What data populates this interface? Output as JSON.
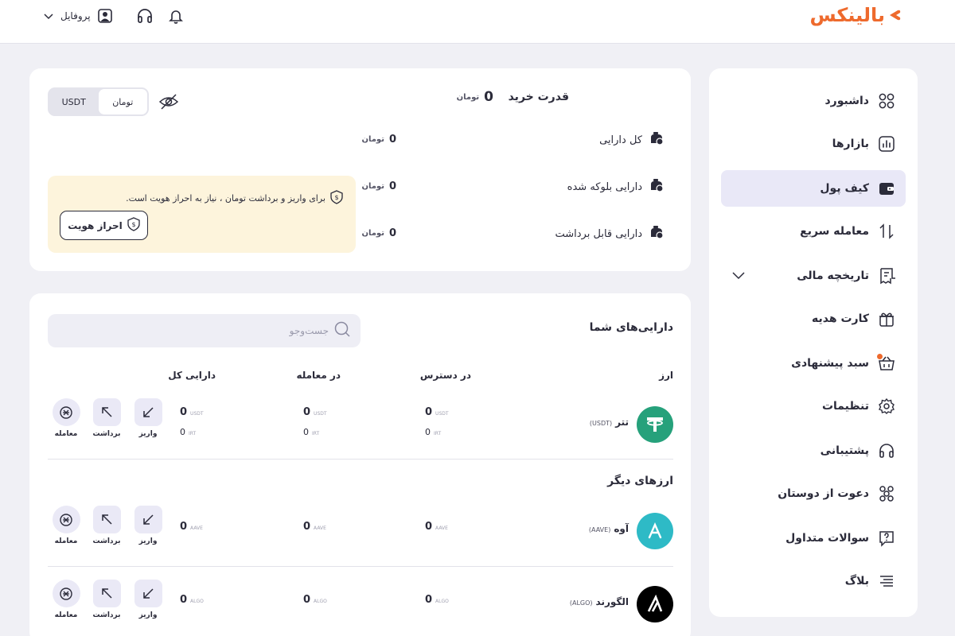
{
  "header": {
    "logo_text": "بالینکس",
    "profile_label": "پروفایل",
    "icons": [
      "chevron-down-icon",
      "user-icon",
      "headset-icon",
      "bell-icon"
    ]
  },
  "sidebar": {
    "items": [
      {
        "label": "داشبورد",
        "icon": "grid-icon"
      },
      {
        "label": "بازارها",
        "icon": "chart-icon"
      },
      {
        "label": "کیف پول",
        "icon": "wallet-icon",
        "active": true
      },
      {
        "label": "معامله سریع",
        "icon": "swap-icon"
      },
      {
        "label": "تاریخچه مالی",
        "icon": "receipt-icon",
        "expandable": true
      },
      {
        "label": "کارت هدیه",
        "icon": "gift-icon"
      },
      {
        "label": "سبد پیشنهادی",
        "icon": "basket-icon",
        "badge": true
      },
      {
        "label": "تنظیمات",
        "icon": "gear-icon"
      },
      {
        "label": "پشتیبانی",
        "icon": "headset-icon"
      },
      {
        "label": "دعوت از دوستان",
        "icon": "users-icon"
      },
      {
        "label": "سوالات متداول",
        "icon": "faq-icon"
      },
      {
        "label": "بلاگ",
        "icon": "list-icon"
      }
    ]
  },
  "summary": {
    "buying_power_label": "قدرت خرید",
    "buying_power_value": "0",
    "currency_sign": "تومان",
    "toggle": {
      "options": [
        "تومان",
        "USDT"
      ],
      "selected": "تومان"
    },
    "rows": [
      {
        "label": "کل دارایی",
        "value": "0"
      },
      {
        "label": "دارایی بلوکه شده",
        "value": "0"
      },
      {
        "label": "دارایی قابل برداشت",
        "value": "0"
      }
    ],
    "kyc": {
      "message": "برای واریز و برداشت تومان ، نیاز به احراز هویت است.",
      "button_label": "احراز هویت"
    }
  },
  "assets": {
    "title": "دارایی‌های شما",
    "search_placeholder": "جست‌وجو",
    "columns": {
      "coin": "ارز",
      "available": "در دسترس",
      "in_trade": "در معامله",
      "total": "دارایی کل"
    },
    "actions": {
      "deposit": "واریز",
      "withdraw": "برداشت",
      "trade": "معامله"
    },
    "primary": [
      {
        "name": "تتر",
        "symbol": "(USDT)",
        "logo_color": "#26a17b",
        "available": "0",
        "in_trade": "0",
        "total": "0",
        "unit": "USDT",
        "sub_available": "0",
        "sub_in_trade": "0",
        "sub_total": "0",
        "sub_unit": "IRT"
      }
    ],
    "other_title": "ارزهای دیگر",
    "others": [
      {
        "name": "آوه",
        "symbol": "(AAVE)",
        "logo_color": "#2ebac6",
        "available": "0",
        "in_trade": "0",
        "total": "0",
        "unit": "AAVE"
      },
      {
        "name": "الگورند",
        "symbol": "(ALGO)",
        "logo_color": "#000000",
        "available": "0",
        "in_trade": "0",
        "total": "0",
        "unit": "ALGO"
      }
    ]
  }
}
